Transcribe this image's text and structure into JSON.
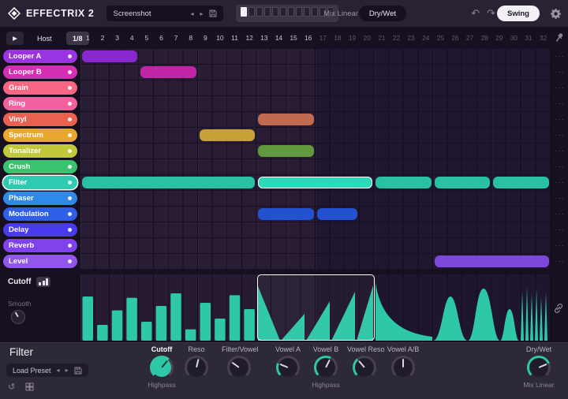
{
  "topbar": {
    "logo_text": "EFFECTRIX 2",
    "preset_value": "Screenshot",
    "mix_mode_label": "Mix Linear",
    "drywet_label": "Dry/Wet",
    "swing_label": "Swing"
  },
  "transport": {
    "host_label": "Host",
    "rate_label": "1/8"
  },
  "grid": {
    "step_numbers": [
      1,
      2,
      3,
      4,
      5,
      6,
      7,
      8,
      9,
      10,
      11,
      12,
      13,
      14,
      15,
      16,
      17,
      18,
      19,
      20,
      21,
      22,
      23,
      24,
      25,
      26,
      27,
      28,
      29,
      30,
      31,
      32
    ],
    "row_menu_icon": "···"
  },
  "tracks": [
    {
      "label": "Looper A",
      "color": "#9a34e0",
      "block_color": "#8a28cf",
      "blocks": [
        {
          "start": 1,
          "len": 4
        }
      ]
    },
    {
      "label": "Looper B",
      "color": "#d32eb4",
      "block_color": "#c026a6",
      "blocks": [
        {
          "start": 5,
          "len": 4
        }
      ]
    },
    {
      "label": "Grain",
      "color": "#f76683",
      "blocks": []
    },
    {
      "label": "Ring",
      "color": "#f2609d",
      "blocks": []
    },
    {
      "label": "Vinyl",
      "color": "#ea6150",
      "block_color": "#c06a4f",
      "blocks": [
        {
          "start": 13,
          "len": 4
        }
      ]
    },
    {
      "label": "Spectrum",
      "color": "#eaa72e",
      "block_color": "#c7a036",
      "blocks": [
        {
          "start": 9,
          "len": 4
        }
      ]
    },
    {
      "label": "Tonalizer",
      "color": "#c2c83c",
      "block_color": "#62993f",
      "blocks": [
        {
          "start": 13,
          "len": 4
        }
      ]
    },
    {
      "label": "Crush",
      "color": "#38c46e",
      "blocks": []
    },
    {
      "label": "Filter",
      "color": "#2fcbb1",
      "block_color": "#2bbfa6",
      "selected": true,
      "blocks": [
        {
          "start": 1,
          "len": 12
        },
        {
          "start": 13,
          "len": 8,
          "selected": true
        },
        {
          "start": 21,
          "len": 4
        },
        {
          "start": 25,
          "len": 4
        },
        {
          "start": 29,
          "len": 4
        }
      ]
    },
    {
      "label": "Phaser",
      "color": "#2f89e6",
      "blocks": []
    },
    {
      "label": "Modulation",
      "color": "#2e5fe6",
      "block_color": "#2451d0",
      "blocks": [
        {
          "start": 13,
          "len": 4
        },
        {
          "start": 17,
          "len": 3
        }
      ]
    },
    {
      "label": "Delay",
      "color": "#4a3aed",
      "blocks": []
    },
    {
      "label": "Reverb",
      "color": "#7f42ec",
      "blocks": []
    },
    {
      "label": "Level",
      "color": "#9156ee",
      "block_color": "#7c48da",
      "blocks": [
        {
          "start": 25,
          "len": 8
        }
      ]
    }
  ],
  "editor": {
    "param_label": "Cutoff",
    "smooth_label": "Smooth",
    "selection": {
      "start": 13,
      "len": 8
    },
    "bar_values": [
      0.7,
      0.25,
      0.48,
      0.68,
      0.3,
      0.55,
      0.75,
      0.18,
      0.6,
      0.35,
      0.72,
      0.5
    ]
  },
  "bottom": {
    "title": "Filter",
    "preset_label": "Load Preset",
    "knobs": [
      {
        "label": "Cutoff",
        "sub": "Highpass",
        "arc": 0.65,
        "style": "teal",
        "ring": "teal",
        "active": true
      },
      {
        "label": "Reso",
        "arc": 0.55,
        "ring": "plain"
      },
      {
        "label": "Filter/Vowel",
        "arc": 0.3,
        "ring": "plain"
      },
      {
        "label": "Vowel A",
        "arc": 0.25,
        "ring": "teal"
      },
      {
        "label": "Vowel B",
        "sub": "Highpass",
        "arc": 0.6,
        "ring": "teal"
      },
      {
        "label": "Vowel Reso",
        "arc": 0.35,
        "ring": "teal"
      },
      {
        "label": "Vowel A/B",
        "arc": 0.5,
        "ring": "plain"
      }
    ],
    "drywet_knob": {
      "label": "Dry/Wet",
      "sub": "Mix Linear",
      "arc": 0.75,
      "ring": "teal"
    }
  },
  "icons": {
    "prev": "◂",
    "next": "▸",
    "undo": "↶",
    "redo": "↷",
    "play": "▶",
    "reset": "↺"
  }
}
